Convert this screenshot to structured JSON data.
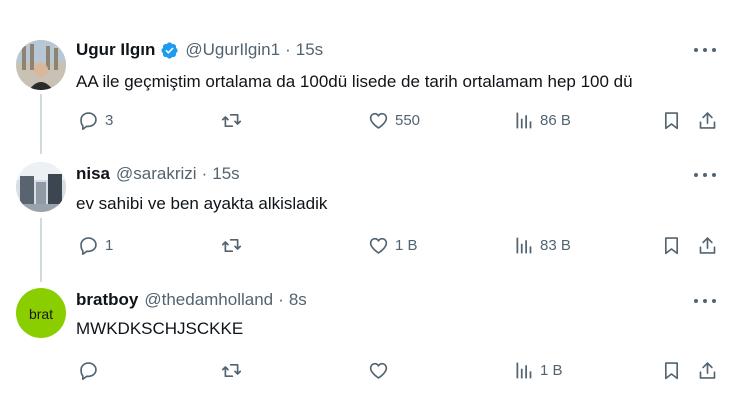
{
  "tweets": [
    {
      "name": "Ugur Ilgın",
      "handle": "@UgurIlgin1",
      "separator": "·",
      "time": "15s",
      "verified": true,
      "text": "AA ile geçmiştim ortalama da 100dü lisede de tarih ortalamam hep 100 dü",
      "replies": "3",
      "reposts": "",
      "likes": "550",
      "views": "86 B"
    },
    {
      "name": "nisa",
      "handle": "@sarakrizi",
      "separator": "·",
      "time": "15s",
      "verified": false,
      "text": "ev sahibi ve ben ayakta alkisladik",
      "replies": "1",
      "reposts": "",
      "likes": "1 B",
      "views": "83 B"
    },
    {
      "name": "bratboy",
      "handle": "@thedamholland",
      "separator": "·",
      "time": "8s",
      "verified": false,
      "avatar_text": "brat",
      "text": "MWKDKSCHJSCKKE",
      "replies": "",
      "reposts": "",
      "likes": "",
      "views": "1 B"
    }
  ],
  "colors": {
    "secondary_text": "#536471",
    "verified_blue": "#1d9bf0",
    "thread_line": "#cfd9de",
    "brat_green": "#8ace00"
  }
}
